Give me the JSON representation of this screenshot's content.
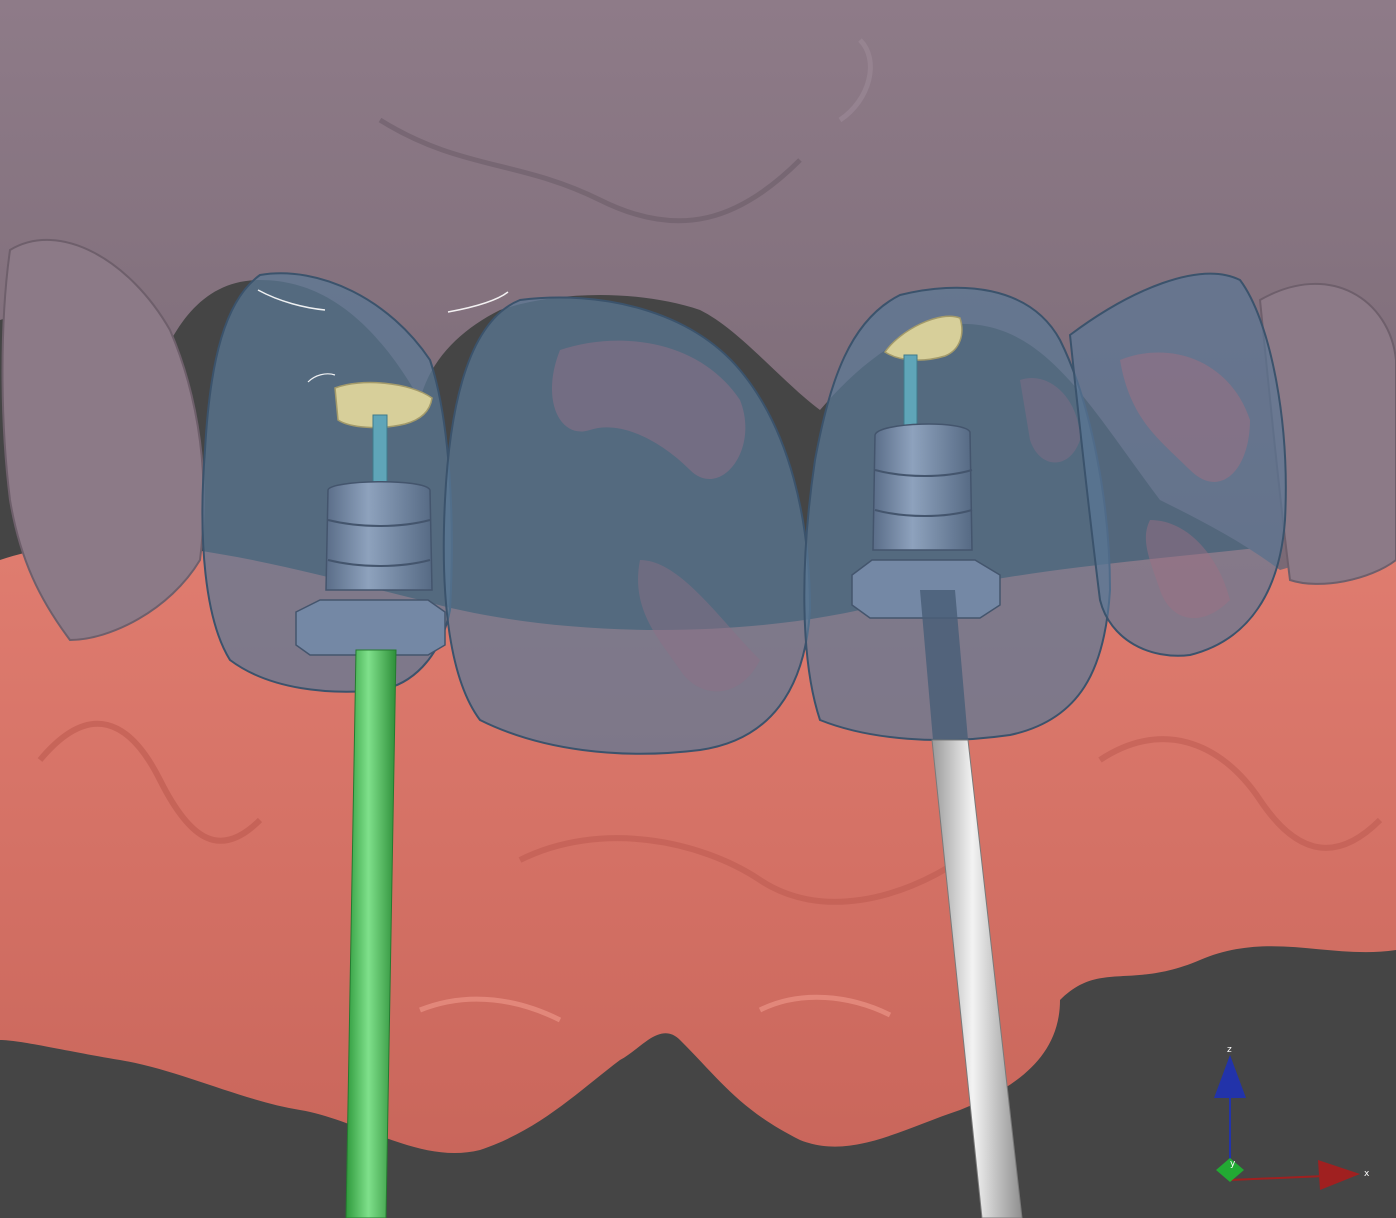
{
  "viewport": {
    "background": "#454545"
  },
  "scene": {
    "upper_gingiva_color": "#85737f",
    "lower_gingiva_color": "#d9766a",
    "crown_color": "#5a7896",
    "abutment_color": "#6f85a3",
    "scanbody_tip_color": "#d7cf9a",
    "guide_pin_left_color": "#4cc35a",
    "guide_pin_right_color": "#cfcfcf"
  },
  "axis_triad": {
    "z_label": "z",
    "x_label": "x",
    "y_label": "y",
    "z_color": "#2233aa",
    "x_color": "#a02020",
    "y_color": "#22aa33"
  }
}
